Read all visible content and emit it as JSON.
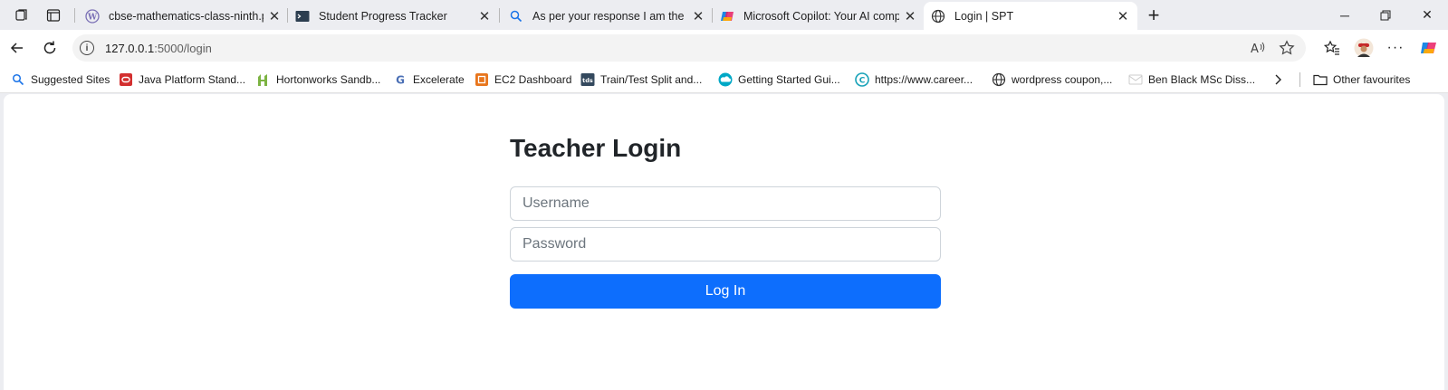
{
  "tabs": [
    {
      "title": "cbse-mathematics-class-ninth.pdf",
      "icon": "wordpress-icon",
      "active": false
    },
    {
      "title": "Student Progress Tracker",
      "icon": "terminal-icon",
      "active": false
    },
    {
      "title": "As per your response I am the Ca",
      "icon": "search-icon",
      "active": false
    },
    {
      "title": "Microsoft Copilot: Your AI compa",
      "icon": "copilot-icon",
      "active": false
    },
    {
      "title": "Login | SPT",
      "icon": "globe-icon",
      "active": true
    }
  ],
  "address": {
    "host": "127.0.0.1",
    "path": ":5000/login"
  },
  "favorites": [
    {
      "label": "Suggested Sites",
      "icon": "search-icon"
    },
    {
      "label": "Java Platform Stand...",
      "icon": "oracle-icon"
    },
    {
      "label": "Hortonworks Sandb...",
      "icon": "hortonworks-icon"
    },
    {
      "label": "Excelerate",
      "icon": "google-icon"
    },
    {
      "label": "EC2 Dashboard",
      "icon": "aws-icon"
    },
    {
      "label": "Train/Test Split and...",
      "icon": "tds-icon"
    },
    {
      "label": "Getting Started Gui...",
      "icon": "cloud-icon"
    },
    {
      "label": "https://www.career...",
      "icon": "career-icon"
    },
    {
      "label": "wordpress coupon,...",
      "icon": "globe-icon"
    },
    {
      "label": "Ben Black MSc Diss...",
      "icon": "document-icon"
    }
  ],
  "other_favourites": "Other favourites",
  "login": {
    "heading": "Teacher Login",
    "username_placeholder": "Username",
    "password_placeholder": "Password",
    "button": "Log In"
  },
  "colors": {
    "primary": "#0d6efd",
    "heading": "#212529"
  }
}
